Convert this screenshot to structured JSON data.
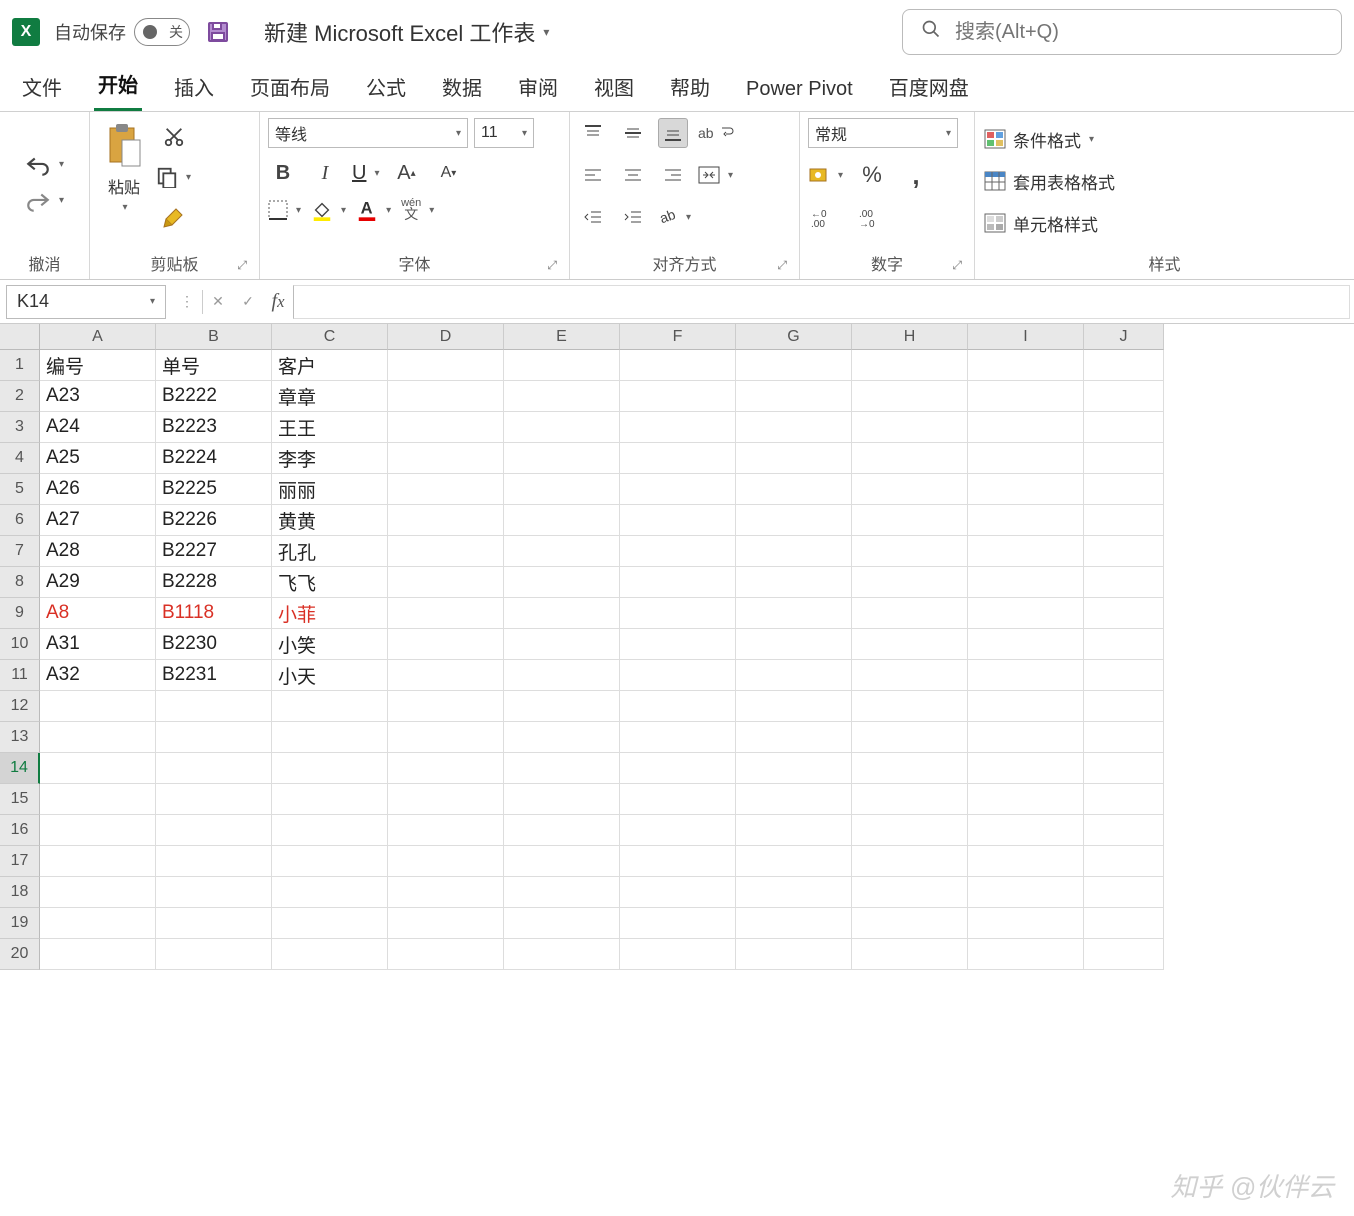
{
  "titlebar": {
    "autosave_label": "自动保存",
    "autosave_state": "关",
    "doc_title": "新建 Microsoft Excel 工作表",
    "search_placeholder": "搜索(Alt+Q)"
  },
  "tabs": [
    "文件",
    "开始",
    "插入",
    "页面布局",
    "公式",
    "数据",
    "审阅",
    "视图",
    "帮助",
    "Power Pivot",
    "百度网盘"
  ],
  "active_tab": "开始",
  "ribbon": {
    "undo_label": "撤消",
    "clipboard_label": "剪贴板",
    "paste_label": "粘贴",
    "font_label": "字体",
    "font_name": "等线",
    "font_size": "11",
    "wen": "wén",
    "wen2": "文",
    "align_label": "对齐方式",
    "wrap": "ab",
    "number_label": "数字",
    "number_format": "常规",
    "styles_label": "样式",
    "cond_format": "条件格式",
    "table_format": "套用表格格式",
    "cell_styles": "单元格样式"
  },
  "formula": {
    "namebox": "K14",
    "value": ""
  },
  "columns": [
    "A",
    "B",
    "C",
    "D",
    "E",
    "F",
    "G",
    "H",
    "I",
    "J"
  ],
  "row_count": 20,
  "active_row": 14,
  "highlight_row": 9,
  "data": [
    [
      "编号",
      "单号",
      "客户"
    ],
    [
      "A23",
      "B2222",
      "章章"
    ],
    [
      "A24",
      "B2223",
      "王王"
    ],
    [
      "A25",
      "B2224",
      "李李"
    ],
    [
      "A26",
      "B2225",
      "丽丽"
    ],
    [
      "A27",
      "B2226",
      "黄黄"
    ],
    [
      "A28",
      "B2227",
      "孔孔"
    ],
    [
      "A29",
      "B2228",
      "飞飞"
    ],
    [
      "A8",
      "B1118",
      "小菲"
    ],
    [
      "A31",
      "B2230",
      "小笑"
    ],
    [
      "A32",
      "B2231",
      "小天"
    ]
  ],
  "watermark": "知乎 @伙伴云"
}
